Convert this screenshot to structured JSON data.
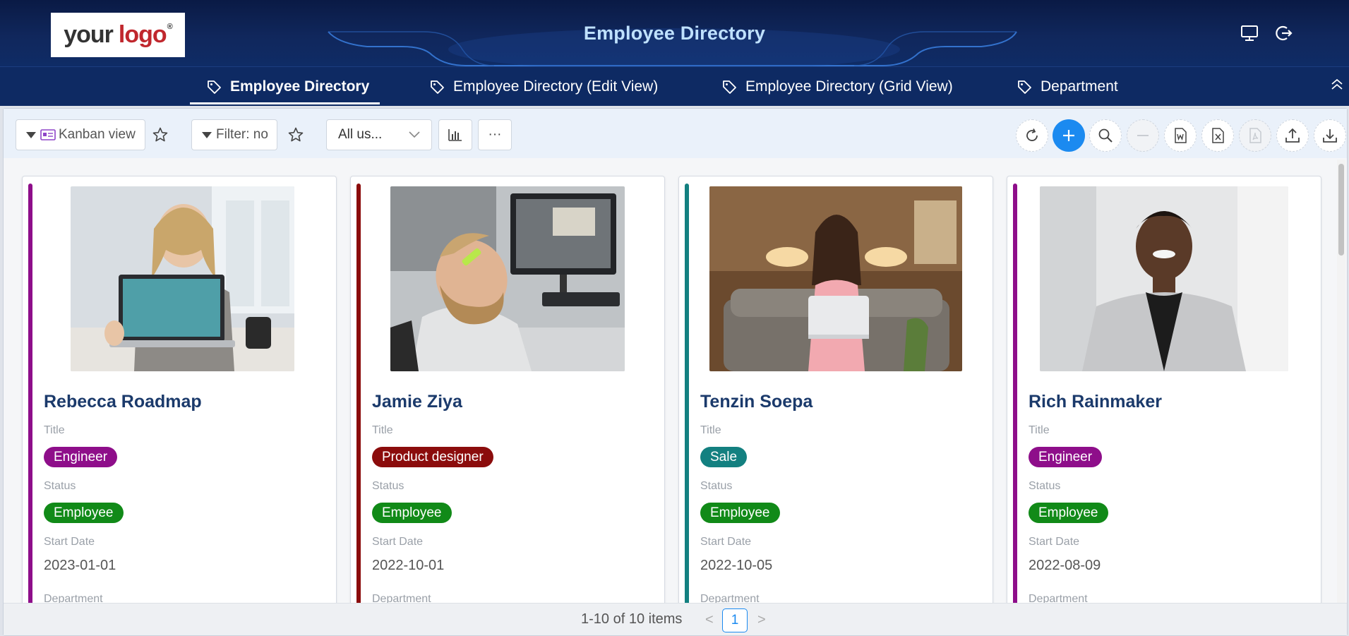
{
  "header": {
    "logo_text_1": "your",
    "logo_text_2": "logo",
    "logo_mark": "®",
    "title": "Employee Directory",
    "icons": [
      "monitor-icon",
      "logout-icon"
    ]
  },
  "tabs": [
    {
      "label": "Employee Directory",
      "active": true,
      "icon": "tag-icon"
    },
    {
      "label": "Employee Directory (Edit View)",
      "active": false,
      "icon": "tag-icon"
    },
    {
      "label": "Employee Directory (Grid View)",
      "active": false,
      "icon": "tag-icon"
    },
    {
      "label": "Department",
      "active": false,
      "icon": "tag-icon"
    }
  ],
  "toolbar": {
    "view_label": "Kanban view",
    "filter_label": "Filter: no",
    "users_select": "All us...",
    "more_label": "···",
    "actions": [
      "refresh-icon",
      "add-icon",
      "search-icon",
      "remove-icon",
      "word-export-icon",
      "excel-export-icon",
      "pdf-export-icon",
      "upload-icon",
      "download-icon"
    ]
  },
  "labels": {
    "title": "Title",
    "status": "Status",
    "start_date": "Start Date",
    "department": "Department"
  },
  "cards": [
    {
      "name": "Rebecca Roadmap",
      "title": "Engineer",
      "title_color": "#8e0e8a",
      "status": "Employee",
      "status_color": "#118a18",
      "start_date": "2023-01-01",
      "bar_color": "#8e0e8a"
    },
    {
      "name": "Jamie Ziya",
      "title": "Product designer",
      "title_color": "#8b0c0c",
      "status": "Employee",
      "status_color": "#118a18",
      "start_date": "2022-10-01",
      "bar_color": "#8b0c0c"
    },
    {
      "name": "Tenzin Soepa",
      "title": "Sale",
      "title_color": "#138080",
      "status": "Employee",
      "status_color": "#118a18",
      "start_date": "2022-10-05",
      "bar_color": "#138080"
    },
    {
      "name": "Rich Rainmaker",
      "title": "Engineer",
      "title_color": "#8e0e8a",
      "status": "Employee",
      "status_color": "#118a18",
      "start_date": "2022-08-09",
      "bar_color": "#8e0e8a"
    }
  ],
  "pagination": {
    "info": "1-10 of 10 items",
    "current_page": "1",
    "prev": "<",
    "next": ">"
  }
}
